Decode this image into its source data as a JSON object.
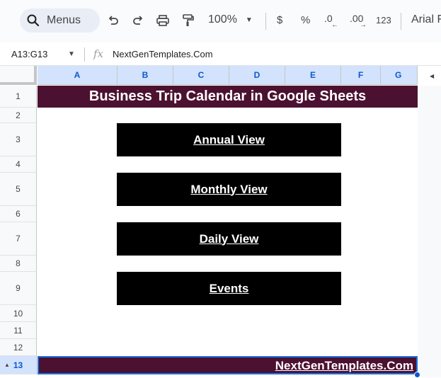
{
  "toolbar": {
    "search_label": "Menus",
    "zoom": "100%",
    "currency": "$",
    "percent": "%",
    "decrease_decimal": ".0",
    "increase_decimal": ".00",
    "number_format": "123",
    "font": "Arial F"
  },
  "formula_bar": {
    "name_box": "A13:G13",
    "fx": "fx",
    "formula": "NextGenTemplates.Com"
  },
  "columns": [
    "A",
    "B",
    "C",
    "D",
    "E",
    "F",
    "G"
  ],
  "rows": [
    "1",
    "2",
    "3",
    "4",
    "5",
    "6",
    "7",
    "8",
    "9",
    "10",
    "11",
    "12",
    "13"
  ],
  "sheet": {
    "title": "Business Trip Calendar in Google Sheets",
    "buttons": [
      "Annual View",
      "Monthly View",
      "Daily View",
      "Events"
    ],
    "footer_link": "NextGenTemplates.Com"
  },
  "colors": {
    "title_bg": "#4c1130",
    "button_bg": "#000000",
    "selection": "#1a73e8"
  }
}
